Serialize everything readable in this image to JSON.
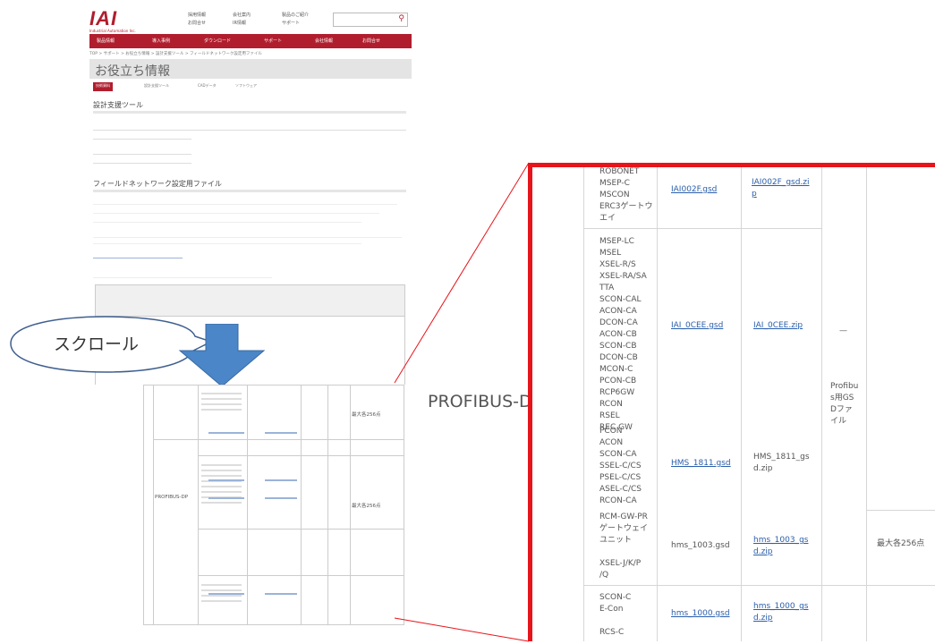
{
  "header": {
    "logo": "IAI",
    "logo_sub": "Industrial Automation Inc.",
    "nav_links": [
      "採用情報",
      "お問合せ",
      "会社案内",
      "IR情報",
      "製品のご紹介",
      "サポート"
    ],
    "search_placeholder": ""
  },
  "main_nav": [
    "製品情報",
    "導入事例",
    "ダウンロード",
    "サポート",
    "会社情報",
    "お問合せ"
  ],
  "breadcrumb": "TOP > サポート > お役立ち情報 > 設計支援ツール > フィールドネットワーク設定用ファイル",
  "page_title": "お役立ち情報",
  "sub_tabs": [
    "技術資料",
    "設計支援ツール",
    "CADデータ",
    "ソフトウェア"
  ],
  "section1_title": "設計支援ツール",
  "section2_title": "フィールドネットワーク設定用ファイル",
  "callout": "スクロール",
  "profibus_label": "PROFIBUS-DP",
  "bottom_thumb": {
    "protocol": "PROFIBUS-DP",
    "max_label": "最大各256点"
  },
  "zoom_table": {
    "rows": [
      {
        "models": "ROBONET\nMSEP-C\nMSCON\nERC3ゲートウ\nエイ",
        "gsd": "IAI002F.gsd",
        "zip": "IAI002F_gsd.zi\np"
      },
      {
        "models": "MSEP-LC\nMSEL\nXSEL-R/S\nXSEL-RA/SA\nTTA\nSCON-CAL\nACON-CA\nDCON-CA\nACON-CB\nSCON-CB\nDCON-CB\nMCON-C\nPCON-CB\nRCP6GW\nRCON\nRSEL\nREC GW",
        "gsd": "IAI_0CEE.gsd",
        "zip": "IAI_0CEE.zip"
      },
      {
        "models": "PCON\nACON\nSCON-CA\nSSEL-C/CS\nPSEL-C/CS\nASEL-C/CS\nRCON-CA",
        "gsd": "HMS_1811.gsd",
        "zip": "HMS_1811_gs\nd.zip"
      },
      {
        "models": "RCM-GW-PR\nゲートウェイ\nユニット\n\nXSEL-J/K/P\n/Q",
        "gsd": "hms_1003.gsd",
        "zip": "hms_1003_gs\nd.zip"
      },
      {
        "models": "SCON-C\nE-Con\n\nRCS-C",
        "gsd": "hms_1000.gsd",
        "zip": "hms_1000_gs\nd.zip"
      }
    ],
    "dash": "—",
    "profile_label": "Profibu\ns用GS\nDファ\nイル",
    "max_points": "最大各256点"
  }
}
